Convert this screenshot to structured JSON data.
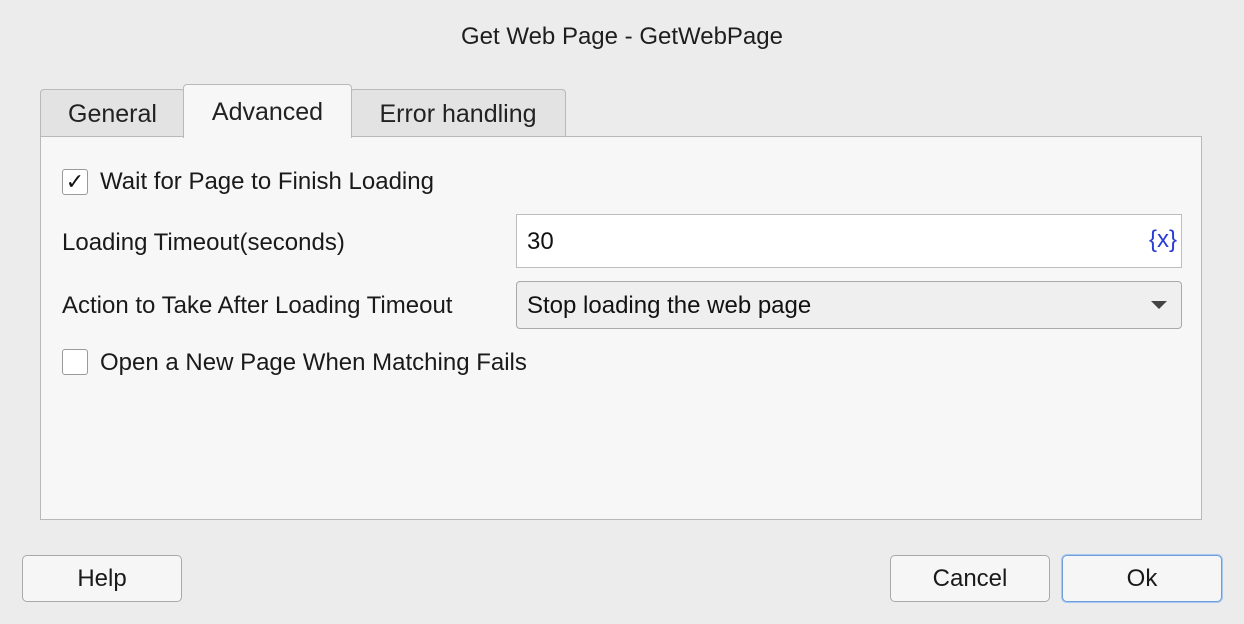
{
  "dialog": {
    "title": "Get Web Page - GetWebPage"
  },
  "tabs": [
    {
      "label": "General",
      "active": false
    },
    {
      "label": "Advanced",
      "active": true
    },
    {
      "label": "Error handling",
      "active": false
    }
  ],
  "advanced": {
    "wait_checkbox": {
      "label": "Wait for Page to Finish Loading",
      "checked": true,
      "mark": "✓"
    },
    "timeout": {
      "label": "Loading Timeout(seconds)",
      "value": "30",
      "variable_icon": "{x}"
    },
    "timeout_action": {
      "label": "Action to Take After Loading Timeout",
      "selected": "Stop loading the web page"
    },
    "new_page_checkbox": {
      "label": "Open a New Page When Matching Fails",
      "checked": false
    }
  },
  "buttons": {
    "help": "Help",
    "cancel": "Cancel",
    "ok": "Ok"
  },
  "colors": {
    "background": "#ececec",
    "panel": "#f7f7f7",
    "variable_icon": "#2a3dd6",
    "default_button_border": "#6f9fdb"
  }
}
